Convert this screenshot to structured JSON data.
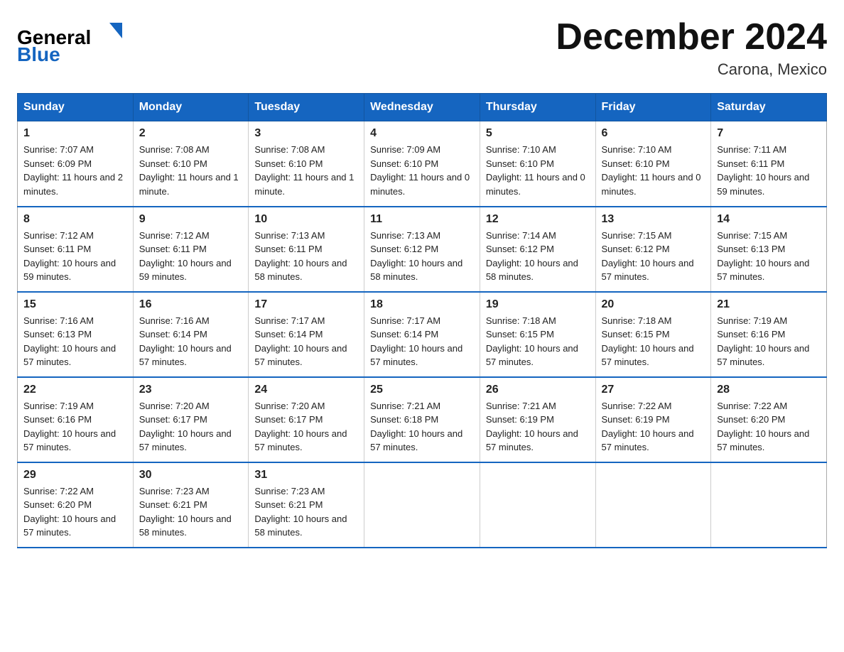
{
  "header": {
    "logo_general": "General",
    "logo_blue": "Blue",
    "month_title": "December 2024",
    "location": "Carona, Mexico"
  },
  "weekdays": [
    "Sunday",
    "Monday",
    "Tuesday",
    "Wednesday",
    "Thursday",
    "Friday",
    "Saturday"
  ],
  "weeks": [
    [
      {
        "day": "1",
        "sunrise": "7:07 AM",
        "sunset": "6:09 PM",
        "daylight": "11 hours and 2 minutes."
      },
      {
        "day": "2",
        "sunrise": "7:08 AM",
        "sunset": "6:10 PM",
        "daylight": "11 hours and 1 minute."
      },
      {
        "day": "3",
        "sunrise": "7:08 AM",
        "sunset": "6:10 PM",
        "daylight": "11 hours and 1 minute."
      },
      {
        "day": "4",
        "sunrise": "7:09 AM",
        "sunset": "6:10 PM",
        "daylight": "11 hours and 0 minutes."
      },
      {
        "day": "5",
        "sunrise": "7:10 AM",
        "sunset": "6:10 PM",
        "daylight": "11 hours and 0 minutes."
      },
      {
        "day": "6",
        "sunrise": "7:10 AM",
        "sunset": "6:10 PM",
        "daylight": "11 hours and 0 minutes."
      },
      {
        "day": "7",
        "sunrise": "7:11 AM",
        "sunset": "6:11 PM",
        "daylight": "10 hours and 59 minutes."
      }
    ],
    [
      {
        "day": "8",
        "sunrise": "7:12 AM",
        "sunset": "6:11 PM",
        "daylight": "10 hours and 59 minutes."
      },
      {
        "day": "9",
        "sunrise": "7:12 AM",
        "sunset": "6:11 PM",
        "daylight": "10 hours and 59 minutes."
      },
      {
        "day": "10",
        "sunrise": "7:13 AM",
        "sunset": "6:11 PM",
        "daylight": "10 hours and 58 minutes."
      },
      {
        "day": "11",
        "sunrise": "7:13 AM",
        "sunset": "6:12 PM",
        "daylight": "10 hours and 58 minutes."
      },
      {
        "day": "12",
        "sunrise": "7:14 AM",
        "sunset": "6:12 PM",
        "daylight": "10 hours and 58 minutes."
      },
      {
        "day": "13",
        "sunrise": "7:15 AM",
        "sunset": "6:12 PM",
        "daylight": "10 hours and 57 minutes."
      },
      {
        "day": "14",
        "sunrise": "7:15 AM",
        "sunset": "6:13 PM",
        "daylight": "10 hours and 57 minutes."
      }
    ],
    [
      {
        "day": "15",
        "sunrise": "7:16 AM",
        "sunset": "6:13 PM",
        "daylight": "10 hours and 57 minutes."
      },
      {
        "day": "16",
        "sunrise": "7:16 AM",
        "sunset": "6:14 PM",
        "daylight": "10 hours and 57 minutes."
      },
      {
        "day": "17",
        "sunrise": "7:17 AM",
        "sunset": "6:14 PM",
        "daylight": "10 hours and 57 minutes."
      },
      {
        "day": "18",
        "sunrise": "7:17 AM",
        "sunset": "6:14 PM",
        "daylight": "10 hours and 57 minutes."
      },
      {
        "day": "19",
        "sunrise": "7:18 AM",
        "sunset": "6:15 PM",
        "daylight": "10 hours and 57 minutes."
      },
      {
        "day": "20",
        "sunrise": "7:18 AM",
        "sunset": "6:15 PM",
        "daylight": "10 hours and 57 minutes."
      },
      {
        "day": "21",
        "sunrise": "7:19 AM",
        "sunset": "6:16 PM",
        "daylight": "10 hours and 57 minutes."
      }
    ],
    [
      {
        "day": "22",
        "sunrise": "7:19 AM",
        "sunset": "6:16 PM",
        "daylight": "10 hours and 57 minutes."
      },
      {
        "day": "23",
        "sunrise": "7:20 AM",
        "sunset": "6:17 PM",
        "daylight": "10 hours and 57 minutes."
      },
      {
        "day": "24",
        "sunrise": "7:20 AM",
        "sunset": "6:17 PM",
        "daylight": "10 hours and 57 minutes."
      },
      {
        "day": "25",
        "sunrise": "7:21 AM",
        "sunset": "6:18 PM",
        "daylight": "10 hours and 57 minutes."
      },
      {
        "day": "26",
        "sunrise": "7:21 AM",
        "sunset": "6:19 PM",
        "daylight": "10 hours and 57 minutes."
      },
      {
        "day": "27",
        "sunrise": "7:22 AM",
        "sunset": "6:19 PM",
        "daylight": "10 hours and 57 minutes."
      },
      {
        "day": "28",
        "sunrise": "7:22 AM",
        "sunset": "6:20 PM",
        "daylight": "10 hours and 57 minutes."
      }
    ],
    [
      {
        "day": "29",
        "sunrise": "7:22 AM",
        "sunset": "6:20 PM",
        "daylight": "10 hours and 57 minutes."
      },
      {
        "day": "30",
        "sunrise": "7:23 AM",
        "sunset": "6:21 PM",
        "daylight": "10 hours and 58 minutes."
      },
      {
        "day": "31",
        "sunrise": "7:23 AM",
        "sunset": "6:21 PM",
        "daylight": "10 hours and 58 minutes."
      },
      null,
      null,
      null,
      null
    ]
  ]
}
